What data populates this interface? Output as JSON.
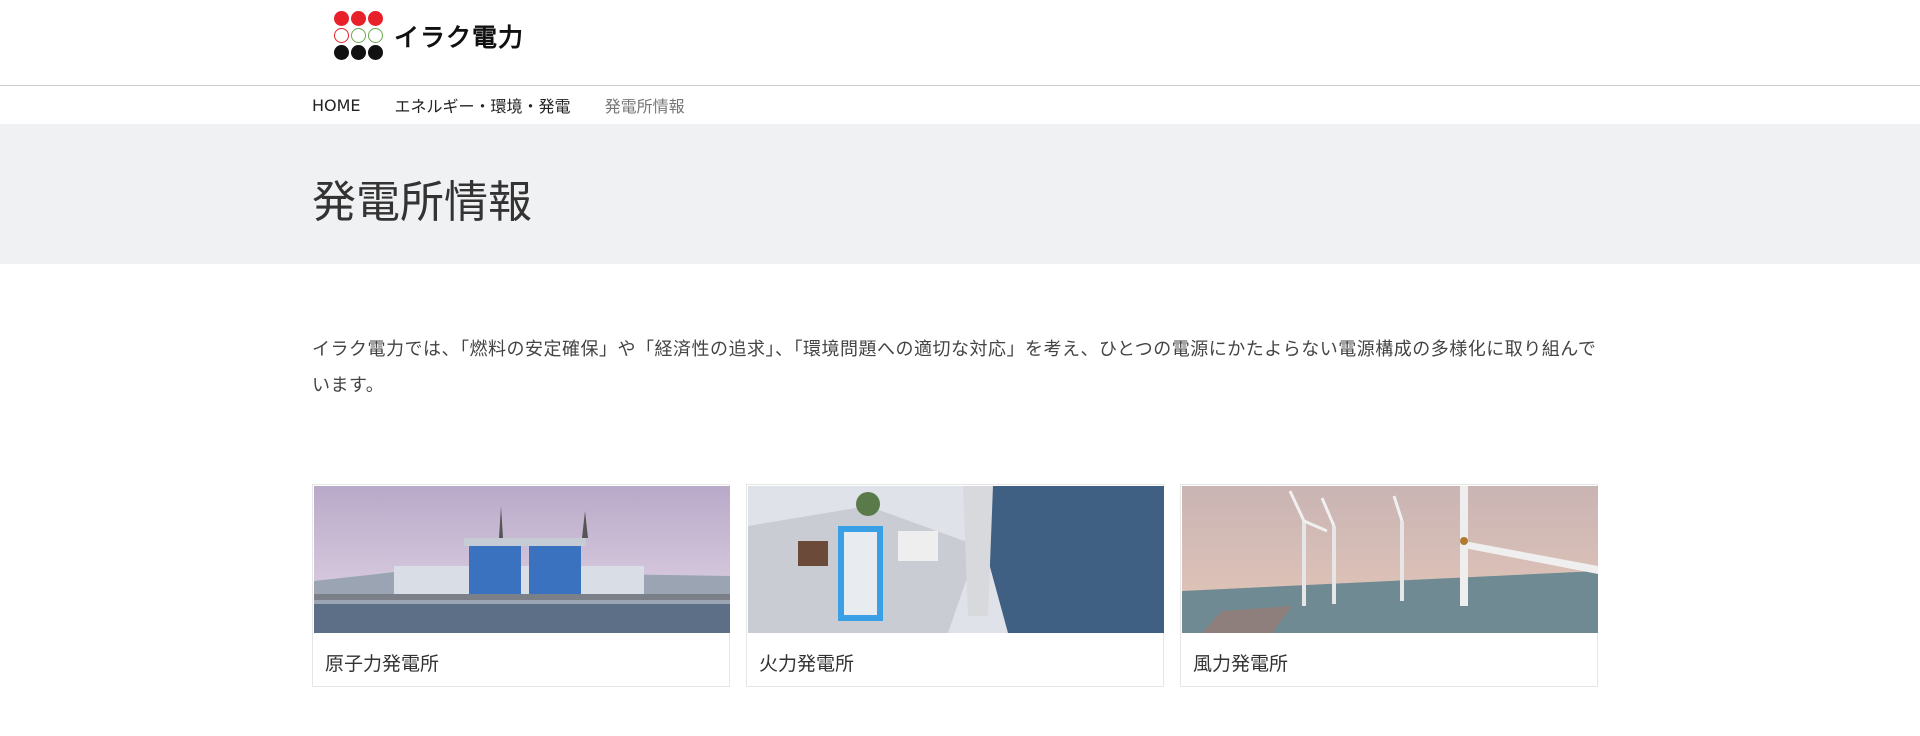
{
  "brand": {
    "name": "イラク電力"
  },
  "breadcrumb": {
    "items": [
      {
        "label": "HOME"
      },
      {
        "label": "エネルギー・環境・発電"
      },
      {
        "label": "発電所情報"
      }
    ]
  },
  "page": {
    "title": "発電所情報",
    "intro": "イラク電力では、「燃料の安定確保」や「経済性の追求」、「環境問題への適切な対応」を考え、ひとつの電源にかたよらない電源構成の多様化に取り組んでいます。"
  },
  "cards": [
    {
      "label": "原子力発電所",
      "image": "nuclear-plant-image"
    },
    {
      "label": "火力発電所",
      "image": "thermal-plant-image"
    },
    {
      "label": "風力発電所",
      "image": "wind-farm-image"
    }
  ]
}
